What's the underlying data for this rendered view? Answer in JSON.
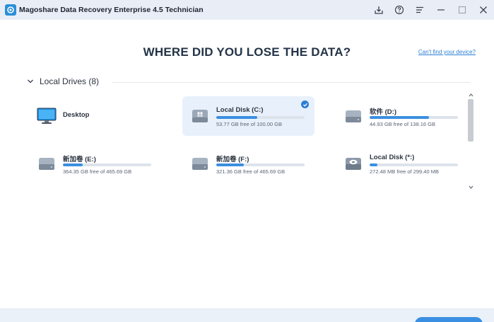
{
  "window": {
    "title": "Magoshare Data Recovery Enterprise 4.5 Technician"
  },
  "main": {
    "heading": "WHERE DID YOU LOSE THE DATA?",
    "cant_find_link": "Can't find your device?"
  },
  "section": {
    "title": "Local Drives (8)"
  },
  "drives": [
    {
      "name": "Desktop",
      "free": "",
      "used_fraction": null,
      "icon": "monitor-icon",
      "selected": false
    },
    {
      "name": "Local Disk (C:)",
      "free": "53.77 GB free of 100.00 GB",
      "used_fraction": 0.46,
      "icon": "windows-drive-icon",
      "selected": true
    },
    {
      "name": "软件 (D:)",
      "free": "44.93 GB free of 138.16 GB",
      "used_fraction": 0.67,
      "icon": "hard-drive-icon",
      "selected": false
    },
    {
      "name": "新加卷 (E:)",
      "free": "364.35 GB free of 465.69 GB",
      "used_fraction": 0.22,
      "icon": "hard-drive-icon",
      "selected": false
    },
    {
      "name": "新加卷 (F:)",
      "free": "321.36 GB free of 465.69 GB",
      "used_fraction": 0.31,
      "icon": "hard-drive-icon",
      "selected": false
    },
    {
      "name": "Local Disk (*:)",
      "free": "272.48 MB free of 299.40 MB",
      "used_fraction": 0.09,
      "icon": "disk-drive-icon",
      "selected": false
    }
  ],
  "colors": {
    "accent": "#2a7fd4",
    "bar_fill": "#3b8fe0",
    "bar_track": "#dde3ea",
    "selected_bg": "#e8f1fb",
    "titlebar_bg": "#e9eef6"
  }
}
